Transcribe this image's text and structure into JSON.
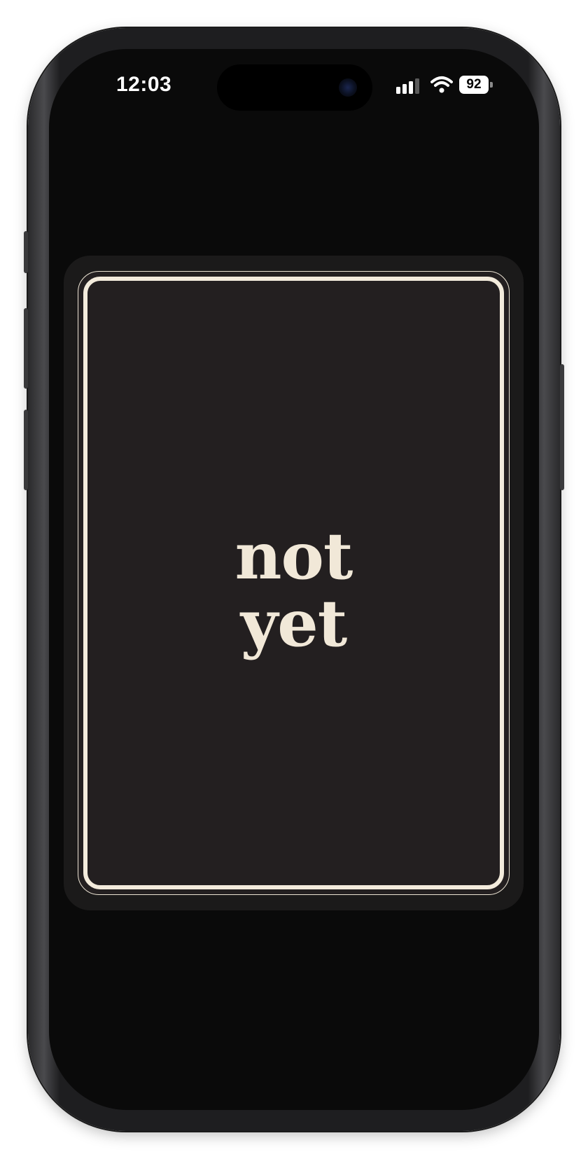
{
  "status_bar": {
    "time": "12:03",
    "battery_level": "92",
    "icons": [
      "signal-icon",
      "wifi-icon",
      "battery-icon"
    ]
  },
  "widget": {
    "line1": "not",
    "line2": "yet"
  },
  "colors": {
    "screen_background": "#0a0a0a",
    "widget_background": "#1b1a1a",
    "card_background": "#231f20",
    "card_border": "#f3ebdc",
    "text": "#f1e8d8"
  }
}
